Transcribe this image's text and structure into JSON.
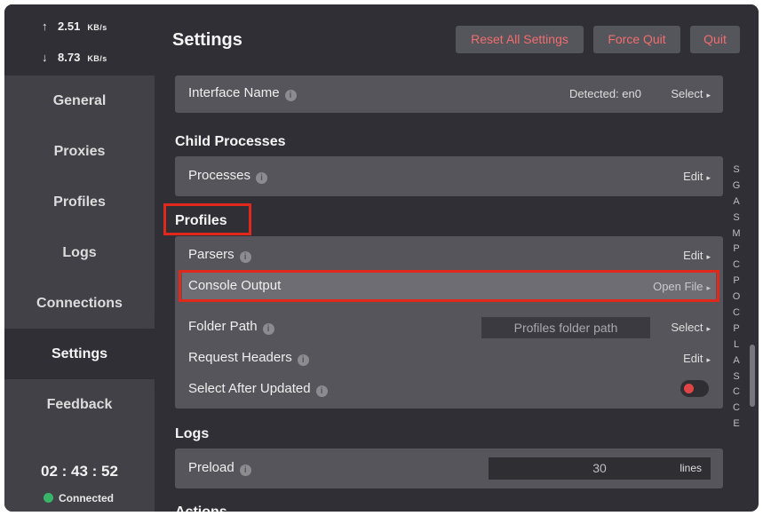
{
  "sidebar": {
    "upload_arrow": "↑",
    "upload_speed": "2.51",
    "upload_unit": "KB/s",
    "download_arrow": "↓",
    "download_speed": "8.73",
    "download_unit": "KB/s",
    "items": [
      {
        "label": "General"
      },
      {
        "label": "Proxies"
      },
      {
        "label": "Profiles"
      },
      {
        "label": "Logs"
      },
      {
        "label": "Connections"
      },
      {
        "label": "Settings"
      },
      {
        "label": "Feedback"
      }
    ],
    "active_item": "Settings",
    "clock": "02 : 43 : 52",
    "status": "Connected",
    "status_color": "#39b56a"
  },
  "header": {
    "title": "Settings",
    "reset_label": "Reset All Settings",
    "force_quit_label": "Force Quit",
    "quit_label": "Quit",
    "accent": "#f06e6e"
  },
  "interface": {
    "label": "Interface Name",
    "detected": "Detected: en0",
    "action": "Select"
  },
  "child_processes": {
    "title": "Child Processes",
    "processes_label": "Processes",
    "processes_action": "Edit"
  },
  "profiles": {
    "title": "Profiles",
    "parsers_label": "Parsers",
    "parsers_action": "Edit",
    "console_label": "Console Output",
    "console_action": "Open File",
    "folder_label": "Folder Path",
    "folder_placeholder": "Profiles folder path",
    "folder_action": "Select",
    "headers_label": "Request Headers",
    "headers_action": "Edit",
    "select_after_label": "Select After Updated",
    "select_after_on": false
  },
  "logs": {
    "title": "Logs",
    "preload_label": "Preload",
    "preload_value": "30",
    "preload_unit": "lines"
  },
  "actions": {
    "title": "Actions"
  },
  "alpha_index": [
    "S",
    "G",
    "A",
    "S",
    "M",
    "P",
    "C",
    "P",
    "O",
    "C",
    "P",
    "L",
    "A",
    "S",
    "C",
    "C",
    "E"
  ],
  "info_glyph": "i",
  "caret_glyph": "▸",
  "highlight_color": "#e0291b"
}
